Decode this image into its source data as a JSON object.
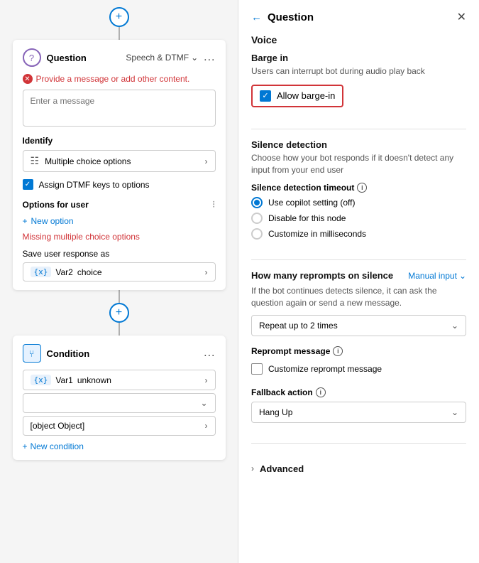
{
  "left": {
    "add_top": "+",
    "question_card": {
      "icon_label": "?",
      "title": "Question",
      "subtitle": "Speech & DTMF",
      "menu": "...",
      "error_msg": "Provide a message or add other content.",
      "message_placeholder": "Enter a message",
      "identify_label": "Identify",
      "multiple_choice_label": "Multiple choice options",
      "assign_dtmf_label": "Assign DTMF keys to options",
      "options_label": "Options for user",
      "new_option_label": "New option",
      "missing_options_msg": "Missing multiple choice options",
      "save_response_label": "Save user response as",
      "var_label": "{x}",
      "var_name": "Var2",
      "var_value": "choice"
    },
    "add_middle": "+",
    "condition_card": {
      "icon_label": "⑂",
      "title": "Condition",
      "menu": "...",
      "rows": [
        {
          "var": "{x}",
          "var_name": "Var1",
          "var_value": "unknown"
        },
        {
          "label": ""
        },
        {
          "label": "[object Object]"
        }
      ],
      "new_condition": "New condition"
    }
  },
  "right": {
    "back_label": "←",
    "panel_title": "Question",
    "close_label": "✕",
    "section_voice": "Voice",
    "barge_in": {
      "title": "Barge in",
      "desc": "Users can interrupt bot during audio play back",
      "allow_label": "Allow barge-in"
    },
    "silence_detection": {
      "title": "Silence detection",
      "desc": "Choose how your bot responds if it doesn't detect any input from your end user",
      "timeout_label": "Silence detection timeout",
      "options": [
        {
          "label": "Use copilot setting (off)",
          "selected": true
        },
        {
          "label": "Disable for this node",
          "selected": false
        },
        {
          "label": "Customize in milliseconds",
          "selected": false
        }
      ]
    },
    "reprompts": {
      "title": "How many reprompts on silence",
      "manual_input_label": "Manual input",
      "desc": "If the bot continues detects silence, it can ask the question again or send a new message.",
      "repeat_label": "Repeat up to 2 times",
      "reprompt_msg_label": "Reprompt message",
      "customize_reprompt_label": "Customize reprompt message",
      "fallback_label": "Fallback action",
      "fallback_value": "Hang Up"
    },
    "advanced": {
      "label": "Advanced"
    }
  }
}
